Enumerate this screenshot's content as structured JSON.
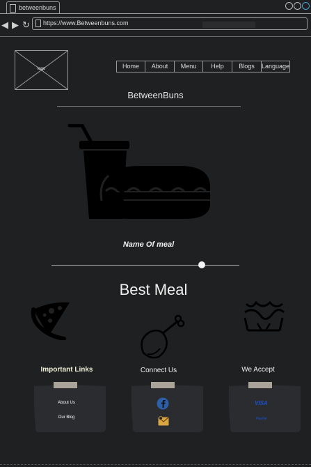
{
  "browser": {
    "tab_title": "betweenbuns",
    "url": "https://www.Betweenbuns.com"
  },
  "header": {
    "logo_label": "logo",
    "menu": [
      {
        "label": "Home"
      },
      {
        "label": "About"
      },
      {
        "label": "Menu"
      },
      {
        "label": "Help"
      },
      {
        "label": "Blogs"
      },
      {
        "label": "Language"
      }
    ]
  },
  "site_name": "BetweenBuns",
  "hero": {
    "icon": "burger-and-drink-icon",
    "meal_name": "Name Of meal",
    "slider_value_fraction": 0.8
  },
  "section_title": "Best Meal",
  "meal_icons": [
    "pizza-slice-icon",
    "chicken-leg-icon",
    "fries-basket-icon"
  ],
  "footer": {
    "important_links": {
      "title": "Important Links",
      "links": [
        "About Us",
        "Our Blog"
      ]
    },
    "connect": {
      "title": "Connect Us",
      "icons": [
        "facebook-icon",
        "email-icon"
      ]
    },
    "accept": {
      "title": "We Accept",
      "payments": [
        "VISA",
        "PayPal"
      ]
    }
  },
  "colors": {
    "background": "#1f2022",
    "border": "#9a9a9a",
    "visa_blue": "#1a4fd0",
    "facebook_blue": "#2d5fa8",
    "email_gold": "#d9a441",
    "note_fill": "#2b2c30"
  }
}
